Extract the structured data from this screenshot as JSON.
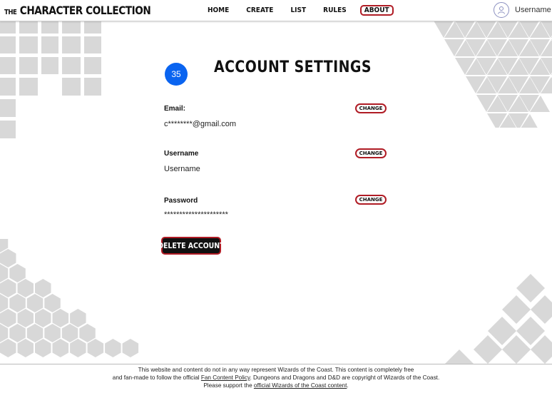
{
  "brand": {
    "prefix": "THE",
    "name": "CHARACTER COLLECTION"
  },
  "nav": [
    {
      "label": "HOME",
      "active": false
    },
    {
      "label": "CREATE",
      "active": false
    },
    {
      "label": "LIST",
      "active": false
    },
    {
      "label": "RULES",
      "active": false
    },
    {
      "label": "ABOUT",
      "active": true
    }
  ],
  "user": {
    "name": "Username",
    "icon": "user-icon"
  },
  "page": {
    "level_badge": "35",
    "title": "ACCOUNT SETTINGS"
  },
  "fields": [
    {
      "label": "Email:",
      "value": "c********@gmail.com",
      "button": "CHANGE"
    },
    {
      "label": "Username",
      "value": "Username",
      "button": "CHANGE"
    },
    {
      "label": "Password",
      "value": "*********************",
      "button": "CHANGE"
    }
  ],
  "delete_button": "DELETE ACCOUNT",
  "footer": {
    "line1": "This website and content do not in any way represent Wizards of the Coast. This content is completely free",
    "line2_pre": "and fan-made to follow the official ",
    "line2_link": "Fan Content Policy",
    "line2_post": ". Dungeons and Dragons and D&D are copyright of Wizards of the Coast.",
    "line3_pre": "Please support the ",
    "line3_link": "official Wizards of the Coast content",
    "line3_post": "."
  },
  "colors": {
    "accent_red": "#b01c25",
    "badge_blue": "#0a64f0",
    "decor_gray": "#d9d9d9"
  }
}
